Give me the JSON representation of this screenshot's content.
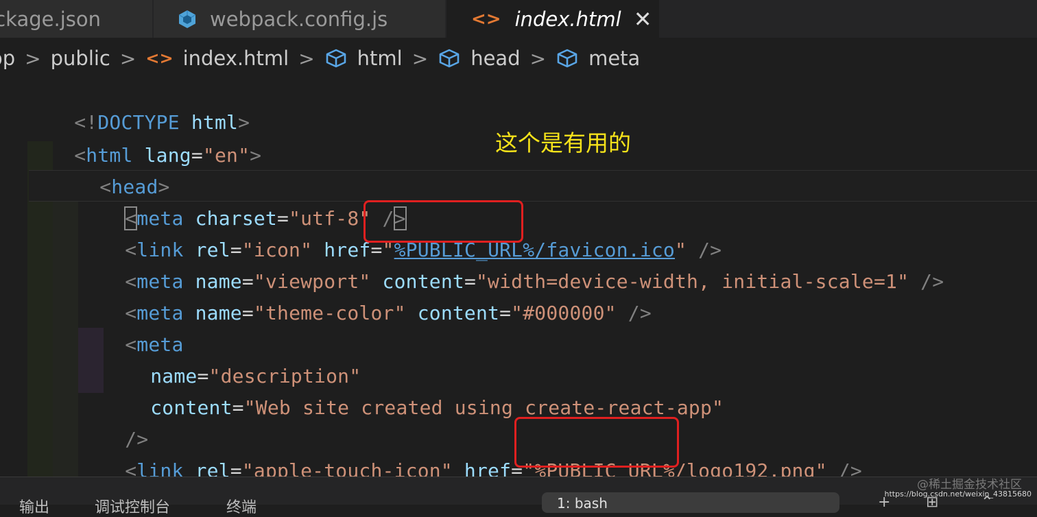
{
  "tabs": [
    {
      "label": "ckage.json",
      "icon": "none"
    },
    {
      "label": "webpack.config.js",
      "icon": "cube-icon"
    },
    {
      "label": "index.html",
      "icon": "code-icon",
      "active": true
    }
  ],
  "breadcrumb": {
    "items": [
      "op",
      "public",
      "index.html",
      "html",
      "head",
      "meta"
    ]
  },
  "code": {
    "line1": {
      "a": "<!",
      "b": "DOCTYPE",
      "c": " html",
      "d": ">"
    },
    "line2": {
      "a": "<",
      "b": "html",
      "c": " lang",
      "d": "=",
      "e": "\"en\"",
      "f": ">"
    },
    "line3": {
      "a": "<",
      "b": "head",
      "c": ">"
    },
    "line4": {
      "a": "<",
      "b": "meta",
      "c": " charset",
      "d": "=",
      "e": "\"utf-8\"",
      "f": " /",
      "g": ">"
    },
    "line5": {
      "a": "<",
      "b": "link",
      "c": " rel",
      "d": "=",
      "e": "\"icon\"",
      "f": " href",
      "g": "=",
      "h": "\"",
      "i": "%PUBLIC_URL%/favicon.ico",
      "j": "\"",
      "k": " />"
    },
    "line6": {
      "a": "<",
      "b": "meta",
      "c": " name",
      "d": "=",
      "e": "\"viewport\"",
      "f": " content",
      "g": "=",
      "h": "\"width=device-width, initial-scale=1\"",
      "i": " />"
    },
    "line7": {
      "a": "<",
      "b": "meta",
      "c": " name",
      "d": "=",
      "e": "\"theme-color\"",
      "f": " content",
      "g": "=",
      "h": "\"#000000\"",
      "i": " />"
    },
    "line8": {
      "a": "<",
      "b": "meta"
    },
    "line9": {
      "a": "name",
      "b": "=",
      "c": "\"description\""
    },
    "line10": {
      "a": "content",
      "b": "=",
      "c": "\"Web site created using create-react-app\""
    },
    "line11": {
      "a": "/>"
    },
    "line12": {
      "a": "<",
      "b": "link",
      "c": " rel",
      "d": "=",
      "e": "\"apple-touch-icon\"",
      "f": " href",
      "g": "=",
      "h": "\"",
      "i": "%PUBLIC_URL%/logo192.png",
      "j": "\"",
      "k": " />"
    },
    "line13": {
      "a": "<!--"
    }
  },
  "annotation": "这个是有用的",
  "panel": {
    "tabs": [
      "输出",
      "调试控制台",
      "终端"
    ],
    "select_value": "1: bash"
  },
  "watermark": {
    "line1": "@稀土掘金技术社区",
    "line2": "https://blog.csdn.net/weixin_43815680"
  },
  "colors": {
    "background": "#1e1e1e",
    "tag": "#569cd6",
    "attribute": "#9cdcfe",
    "string": "#ce9178",
    "annotation": "#f5e21a",
    "highlight_box": "#e02020"
  }
}
